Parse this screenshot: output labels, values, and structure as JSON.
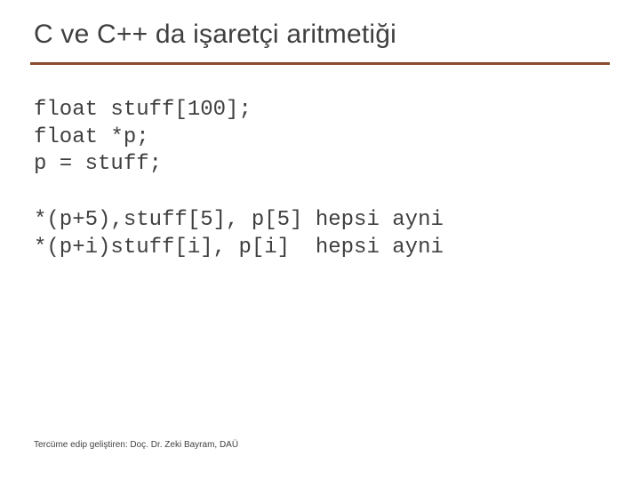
{
  "title": "C ve C++ da işaretçi aritmetiği",
  "code": {
    "decl1": "float stuff[100];",
    "decl2": "float *p;",
    "decl3": "p = stuff;",
    "line1": "*(p+5),stuff[5], p[5] hepsi ayni",
    "line2": "*(p+i)stuff[i], p[i]  hepsi ayni"
  },
  "footer": "Tercüme edip geliştiren: Doç. Dr. Zeki Bayram, DAÜ"
}
